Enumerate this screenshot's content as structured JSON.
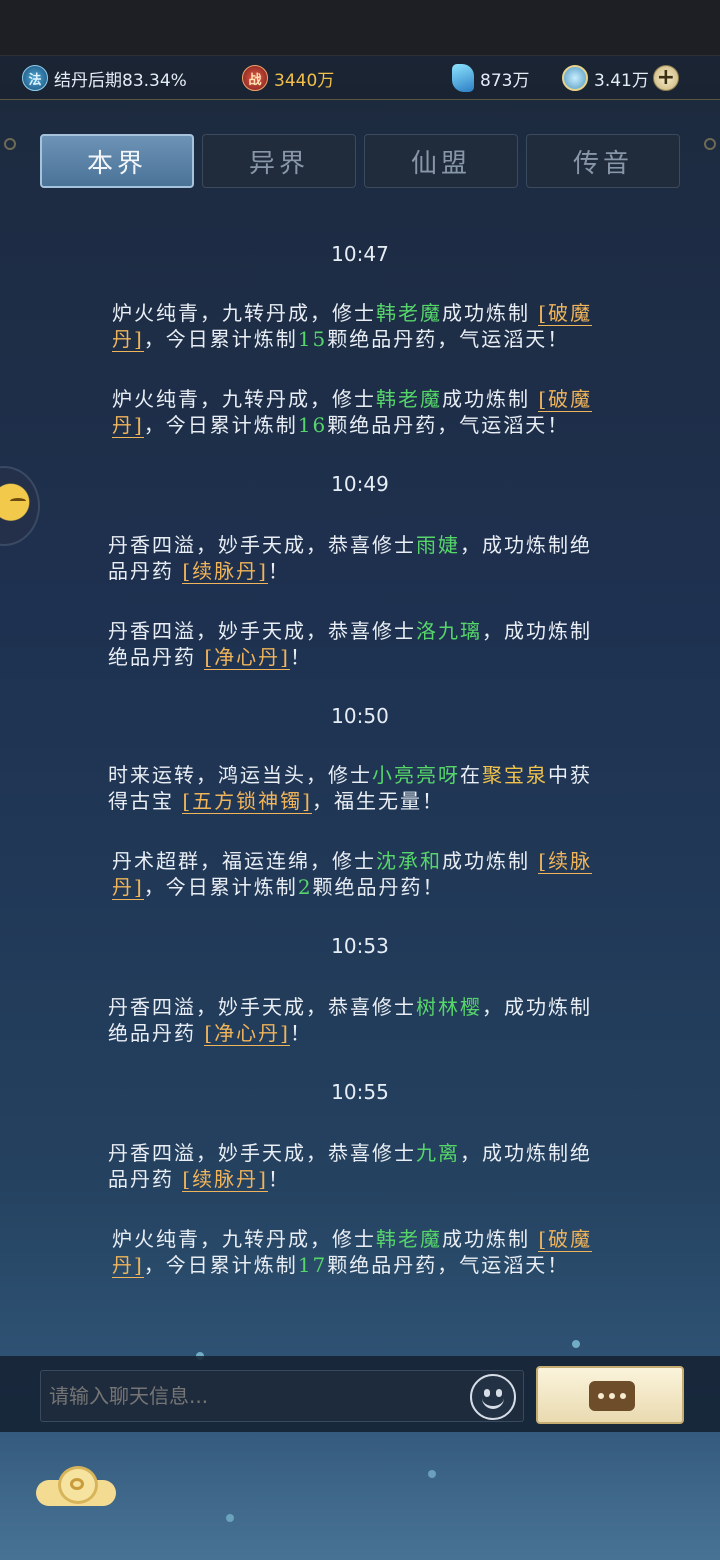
{
  "resources": {
    "realm": {
      "icon": "realm-icon",
      "icon_text": "法",
      "text": "结丹后期83.34%"
    },
    "power": {
      "icon": "battle-power-icon",
      "icon_text": "战",
      "text": "3440万"
    },
    "spirit_stone": {
      "icon": "spirit-stone-icon",
      "text": "873万"
    },
    "spirit_jade": {
      "icon": "spirit-jade-icon",
      "text": "3.41万"
    },
    "plus_icon": "plus-icon",
    "plus_glyph": "+"
  },
  "tabs": [
    {
      "label": "本界",
      "active": true
    },
    {
      "label": "异界",
      "active": false
    },
    {
      "label": "仙盟",
      "active": false
    },
    {
      "label": "传音",
      "active": false
    }
  ],
  "feed": [
    {
      "type": "time",
      "text": "10:47"
    },
    {
      "type": "msg",
      "parts": [
        "炉火纯青，九转丹成，修士",
        "韩老魔",
        "成功炼制 ",
        "[破魔",
        "丹]",
        "，今日累计炼制",
        "15",
        "颗绝品丹药，气运滔天！"
      ]
    },
    {
      "type": "msg",
      "parts": [
        "炉火纯青，九转丹成，修士",
        "韩老魔",
        "成功炼制 ",
        "[破魔",
        "丹]",
        "，今日累计炼制",
        "16",
        "颗绝品丹药，气运滔天！"
      ]
    },
    {
      "type": "time",
      "text": "10:49"
    },
    {
      "type": "msg",
      "parts": [
        "丹香四溢，妙手天成，恭喜修士",
        "雨婕",
        "，成功炼制绝",
        "品丹药 ",
        "[续脉丹]",
        "！"
      ]
    },
    {
      "type": "msg",
      "parts": [
        "丹香四溢，妙手天成，恭喜修士",
        "洛九璃",
        "，成功炼制",
        "绝品丹药 ",
        "[净心丹]",
        "！"
      ]
    },
    {
      "type": "time",
      "text": "10:50"
    },
    {
      "type": "msg",
      "parts": [
        "时来运转，鸿运当头，修士",
        "小亮亮呀",
        "在",
        "聚宝泉",
        "中获",
        "得古宝 ",
        "[五方锁神镯]",
        "，福生无量！"
      ]
    },
    {
      "type": "msg",
      "parts": [
        "丹术超群，福运连绵，修士",
        "沈承和",
        "成功炼制 ",
        "[续脉",
        "丹]",
        "，今日累计炼制",
        "2",
        "颗绝品丹药！"
      ]
    },
    {
      "type": "time",
      "text": "10:53"
    },
    {
      "type": "msg",
      "parts": [
        "丹香四溢，妙手天成，恭喜修士",
        "树林樱",
        "，成功炼制",
        "绝品丹药 ",
        "[净心丹]",
        "！"
      ]
    },
    {
      "type": "time",
      "text": "10:55"
    },
    {
      "type": "msg",
      "parts": [
        "丹香四溢，妙手天成，恭喜修士",
        "九离",
        "，成功炼制绝",
        "品丹药 ",
        "[续脉丹]",
        "！"
      ]
    },
    {
      "type": "msg",
      "parts": [
        "炉火纯青，九转丹成，修士",
        "韩老魔",
        "成功炼制 ",
        "[破魔",
        "丹]",
        "，今日累计炼制",
        "17",
        "颗绝品丹药，气运滔天！"
      ]
    }
  ],
  "input": {
    "placeholder": "请输入聊天信息..."
  },
  "icons": {
    "emoji": "emoji-icon",
    "send": "chat-bubble-icon",
    "cloud": "cloud-menu-icon",
    "side": "side-avatar-icon"
  },
  "colors": {
    "player_name": "#56d66a",
    "item": "#f0b45a",
    "place": "#f0c24c",
    "power": "#f2c04a"
  }
}
